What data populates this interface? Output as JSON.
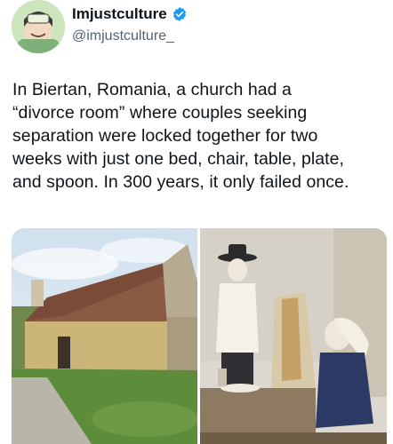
{
  "author": {
    "display_name": "Imjustculture",
    "handle": "@imjustculture_",
    "verified_color": "#1d9bf0",
    "avatar_icon": "avatar-illustration-icon"
  },
  "tweet": {
    "lines": [
      "In Biertan, Romania, a church had a",
      "“divorce room” where couples seeking",
      "separation were locked together for two",
      "weeks with just one bed, chair, table, plate,",
      "and spoon. In 300 years, it only failed once."
    ]
  },
  "media": {
    "photo_1": "church-exterior-photo",
    "photo_2": "divorce-room-interior-photo"
  },
  "colors": {
    "text": "#0f1419",
    "secondary_text": "#536471",
    "accent": "#1d9bf0"
  }
}
